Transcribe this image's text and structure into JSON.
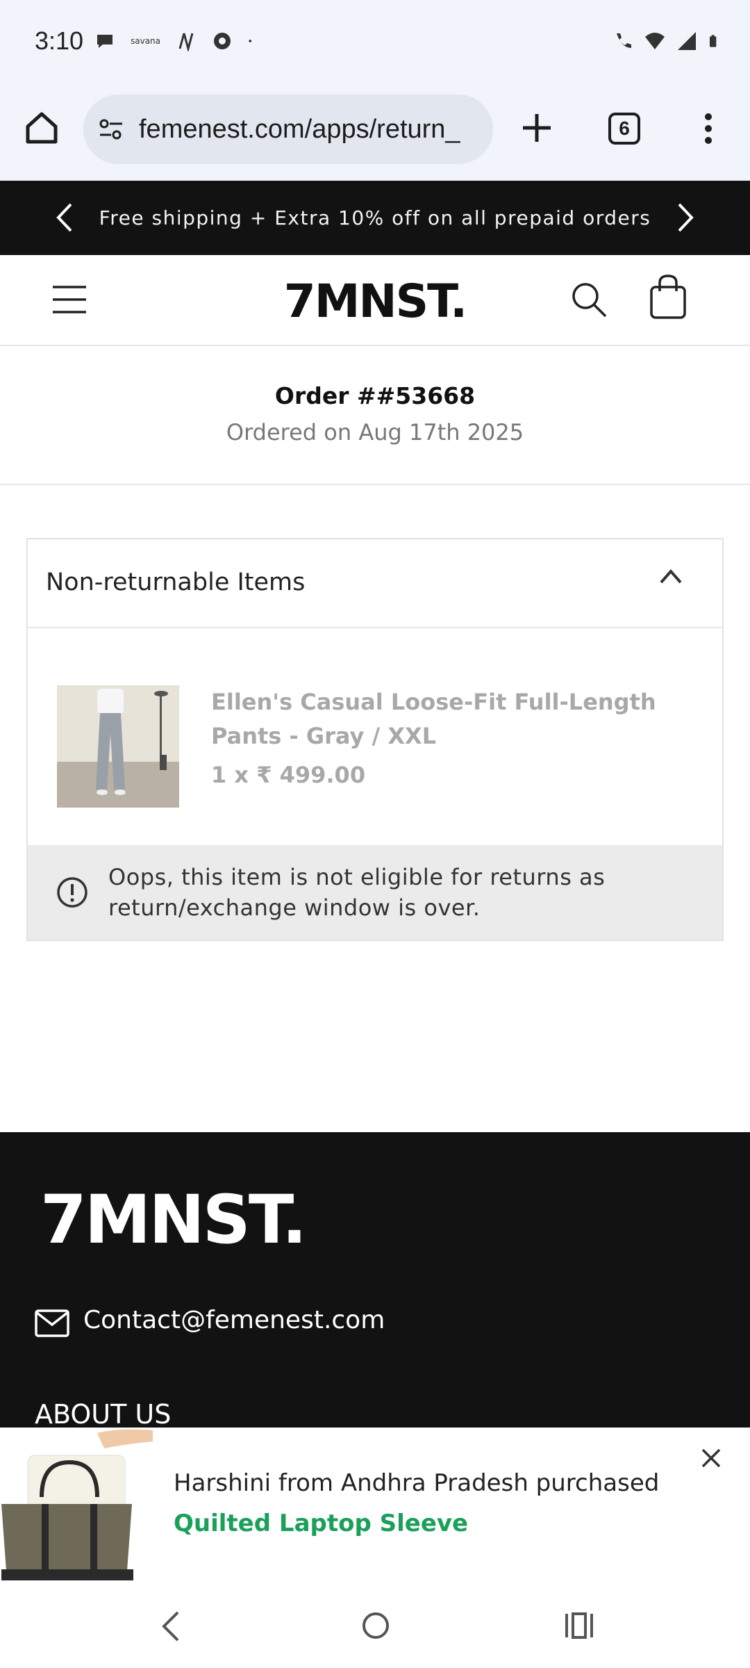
{
  "status_bar": {
    "time": "3:10",
    "left_icons": [
      "chat-bubble-icon",
      "savana-logo-icon",
      "notion-icon",
      "threads-icon",
      "dot-icon"
    ],
    "right_icons": [
      "wifi-call-icon",
      "wifi-icon",
      "signal-icon",
      "battery-icon"
    ],
    "savana_text": "savana"
  },
  "browser": {
    "url": "femenest.com/apps/return_",
    "tab_count": "6"
  },
  "announcement": {
    "text": "Free shipping + Extra 10% off on all prepaid orders"
  },
  "header": {
    "logo": "7MNST."
  },
  "order": {
    "title": "Order ##53668",
    "date": "Ordered on Aug 17th 2025"
  },
  "panel": {
    "title": "Non-returnable Items",
    "item": {
      "name": "Ellen's Casual Loose-Fit Full-Length Pants - Gray / XXL",
      "price": "1 x ₹ 499.00"
    },
    "notice": "Oops, this item is not eligible for returns as return/exchange window is over."
  },
  "footer": {
    "logo": "7MNST.",
    "email": "Contact@femenest.com",
    "about": "ABOUT US"
  },
  "toast": {
    "line1": "Harshini from Andhra Pradesh purchased",
    "product": "Quilted Laptop Sleeve"
  },
  "colors": {
    "announce_bg": "#121212",
    "footer_bg": "#121212",
    "toast_accent": "#1aa05a",
    "notice_bg": "#ebebeb"
  }
}
